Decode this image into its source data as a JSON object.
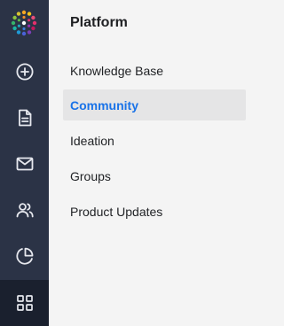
{
  "rail": {
    "logo_icon": "multicolor-dots-logo",
    "icons": [
      "plus-circle-icon",
      "document-icon",
      "mail-icon",
      "users-icon",
      "pie-chart-icon",
      "grid-icon"
    ],
    "active_icon": "grid-icon",
    "colors": {
      "background": "#2b3346",
      "active_background": "#1a202e",
      "icon": "#e6e8ee"
    }
  },
  "panel": {
    "title": "Platform",
    "items": [
      {
        "label": "Knowledge Base",
        "active": false
      },
      {
        "label": "Community",
        "active": true
      },
      {
        "label": "Ideation",
        "active": false
      },
      {
        "label": "Groups",
        "active": false
      },
      {
        "label": "Product Updates",
        "active": false
      }
    ],
    "colors": {
      "background": "#f4f4f4",
      "active_background": "#e5e5e6",
      "active_text": "#1a73e8",
      "text": "#1f2124"
    }
  }
}
